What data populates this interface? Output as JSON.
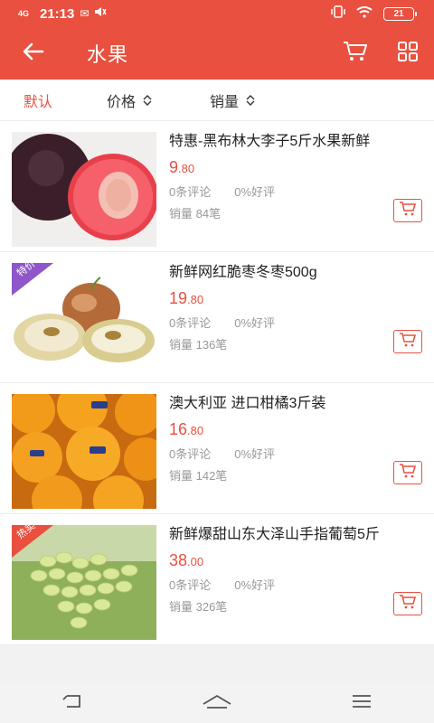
{
  "status_bar": {
    "network": "4G",
    "time": "21:13",
    "battery": "21"
  },
  "header": {
    "title": "水果"
  },
  "sort_bar": {
    "default_label": "默认",
    "price_label": "价格",
    "sales_label": "销量",
    "active": "default"
  },
  "products": [
    {
      "name": "特惠-黑布林大李子5斤水果新鲜",
      "price_int": "9",
      "price_dec": ".80",
      "reviews": "0条评论",
      "good_rate": "0%好评",
      "sales": "销量 84笔",
      "tag": "",
      "image": "plum"
    },
    {
      "name": "新鲜网红脆枣冬枣500g",
      "price_int": "19",
      "price_dec": ".80",
      "reviews": "0条评论",
      "good_rate": "0%好评",
      "sales": "销量 136笔",
      "tag": "特价",
      "image": "jujube"
    },
    {
      "name": "澳大利亚 进口柑橘3斤装",
      "price_int": "16",
      "price_dec": ".80",
      "reviews": "0条评论",
      "good_rate": "0%好评",
      "sales": "销量 142笔",
      "tag": "",
      "image": "orange"
    },
    {
      "name": "新鲜爆甜山东大泽山手指葡萄5斤",
      "price_int": "38",
      "price_dec": ".00",
      "reviews": "0条评论",
      "good_rate": "0%好评",
      "sales": "销量 326笔",
      "tag": "热卖",
      "image": "grape"
    }
  ],
  "colors": {
    "brand": "#e9503f",
    "tag_special": "#8f56c9",
    "tag_hot": "#e9503f"
  },
  "icons": {
    "back": "arrow-left-icon",
    "cart": "cart-icon",
    "grid": "grid-icon",
    "nav_back": "nav-back-icon",
    "nav_home": "nav-home-icon",
    "nav_menu": "nav-menu-icon"
  }
}
